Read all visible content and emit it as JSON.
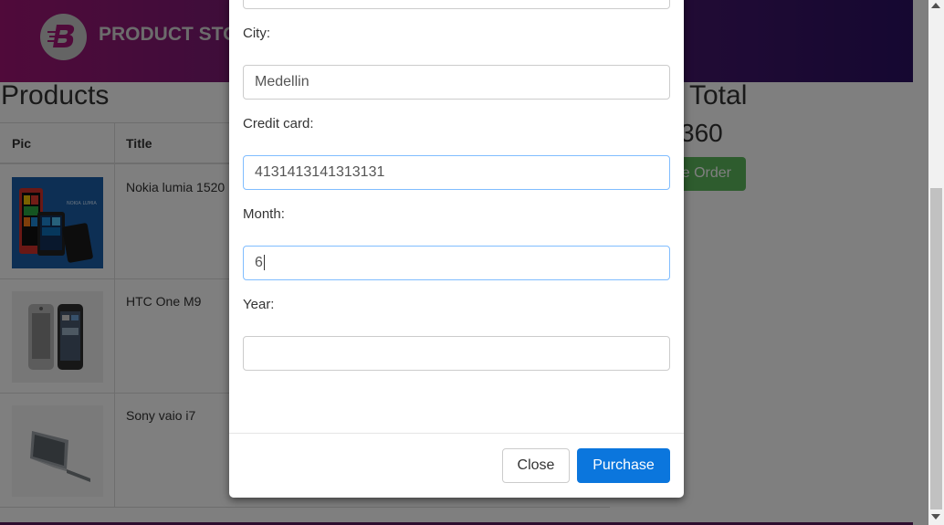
{
  "navbar": {
    "brand": "PRODUCT STORE",
    "logo_icon": "logo-b-icon"
  },
  "main": {
    "heading": "Products",
    "table_headers": [
      "Pic",
      "Title"
    ],
    "rows": [
      {
        "title": "Nokia lumia 1520"
      },
      {
        "title": "HTC One M9"
      },
      {
        "title": "Sony vaio i7"
      }
    ],
    "total_label": "Total",
    "total_value": "360",
    "place_order_label": "Place Order"
  },
  "modal": {
    "fields": [
      {
        "label": "City:",
        "value": "Medellin"
      },
      {
        "label": "Credit card:",
        "value": "4131413141313131"
      },
      {
        "label": "Month:",
        "value": "6"
      },
      {
        "label": "Year:",
        "value": ""
      }
    ],
    "close_label": "Close",
    "purchase_label": "Purchase",
    "purchase_color": "#0b76dd"
  },
  "colors": {
    "nav_gradient_start": "#a01575",
    "nav_gradient_end": "#2b1063",
    "place_order": "#5cb85c"
  }
}
